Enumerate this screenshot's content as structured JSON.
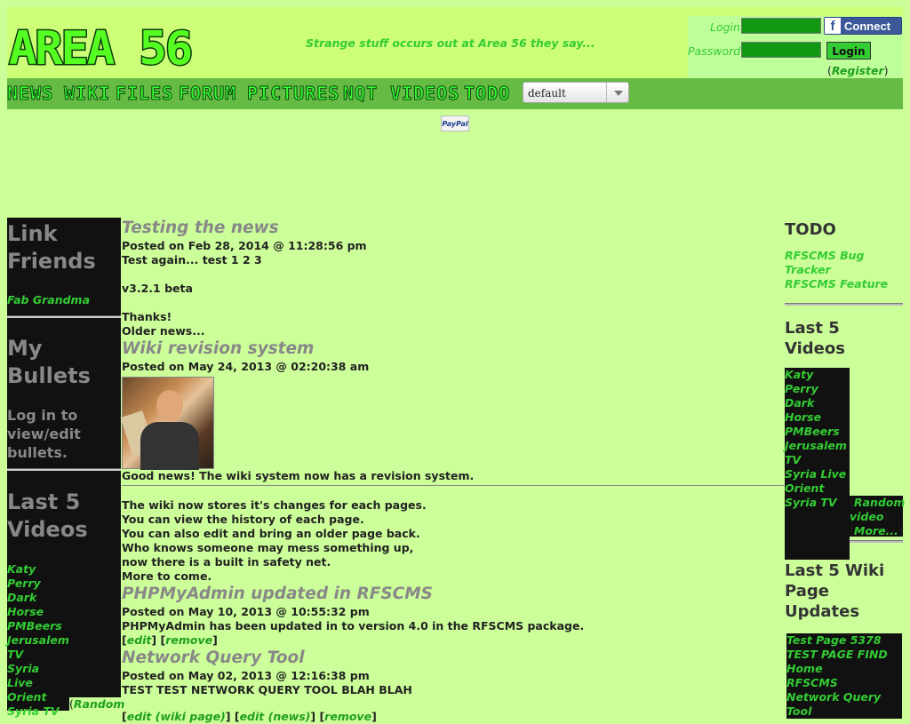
{
  "site": {
    "logo_text": "AREA 56",
    "tagline": "Strange stuff occurs out at Area 56 they say..."
  },
  "login": {
    "login_label": "Login",
    "password_label": "Password",
    "connect_label": "Connect",
    "fb_letter": "f",
    "login_button": "Login",
    "register_label": "Register"
  },
  "nav": {
    "items": [
      "NEWS",
      "WIKI",
      "FILES",
      "FORUM",
      "PICTURES",
      "NQT",
      "VIDEOS",
      "TODO"
    ],
    "theme_select": "default"
  },
  "paypal": "PayPal",
  "left": {
    "link_friends_title": "Link Friends",
    "friend_link": "Fab Grandma",
    "bullets_title": "My Bullets",
    "bullets_text": "Log in to view/edit bullets.",
    "videos_title": "Last 5 Videos",
    "videos": [
      "Katy Perry Dark Horse",
      "PMBeers",
      "Jerusalem TV",
      "Syria Live Orient",
      "Syria TV"
    ],
    "random_label": "Random"
  },
  "center": {
    "posts": [
      {
        "title": "Testing the news",
        "meta": "Posted on Feb 28, 2014 @ 11:28:56 pm",
        "lines": [
          "Test again... test 1 2 3",
          "",
          "v3.2.1 beta",
          "",
          "Thanks!",
          "Older news..."
        ]
      },
      {
        "title": "Wiki revision system",
        "meta": "Posted on May 24, 2013 @ 02:20:38 am",
        "lead": "Good news! The wiki system now has a revision system.",
        "lines": [
          "The wiki now stores it's changes for each pages.",
          "You can view the history of each page.",
          "You can also edit and bring an older page back.",
          "Who knows someone may mess something up,",
          "now there is a built in safety net.",
          "More to come."
        ]
      },
      {
        "title": "PHPMyAdmin updated in RFSCMS",
        "meta": "Posted on May 10, 2013 @ 10:55:32 pm",
        "lines": [
          "PHPMyAdmin has been updated in to version 4.0 in the RFSCMS package."
        ],
        "links": [
          "edit",
          "remove"
        ]
      },
      {
        "title": "Network Query Tool",
        "meta": "Posted on May 02, 2013 @ 12:16:38 pm",
        "lines": [
          "TEST TEST NETWORK QUERY TOOL BLAH BLAH"
        ],
        "links": [
          "edit (wiki page)",
          "edit (news)",
          "remove"
        ]
      }
    ]
  },
  "right": {
    "todo_title": "TODO",
    "todo_links": [
      "RFSCMS Bug Tracker",
      "RFSCMS Feature"
    ],
    "videos_title": "Last 5 Videos",
    "videos": [
      "Katy Perry Dark Horse",
      "PMBeers",
      "Jerusalem TV",
      "Syria Live Orient",
      "Syria TV"
    ],
    "random_label": "Random video",
    "more_label": "More...",
    "wiki_title": "Last 5 Wiki Page Updates",
    "wiki_links": [
      "Test Page 5378",
      "TEST PAGE FIND",
      "Home",
      "RFSCMS",
      "Network Query Tool"
    ]
  }
}
